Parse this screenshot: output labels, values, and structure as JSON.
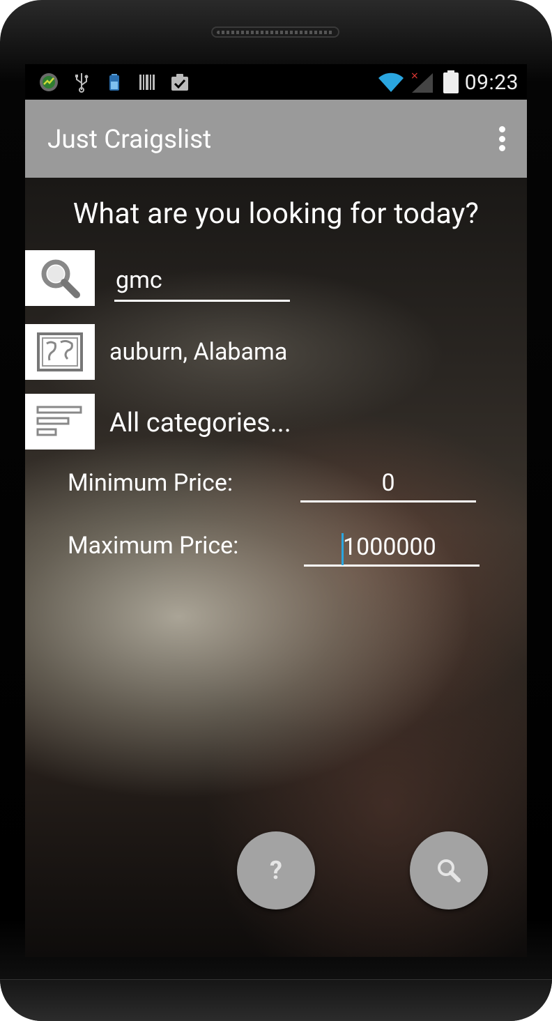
{
  "statusbar": {
    "time": "09:23",
    "left_icons": [
      "app-icon",
      "usb-icon",
      "battery-small-icon",
      "barcode-icon",
      "clipboard-check-icon"
    ],
    "right_icons": [
      "wifi-icon",
      "signal-icon",
      "battery-icon"
    ]
  },
  "appbar": {
    "title": "Just Craigslist"
  },
  "main": {
    "headline": "What are you looking for today?",
    "search_value": "gmc",
    "location": "auburn, Alabama",
    "category": "All categories...",
    "min_price_label": "Minimum Price:",
    "min_price_value": "0",
    "max_price_label": "Maximum Price:",
    "max_price_value": "1000000"
  },
  "fabs": {
    "help_label": "?"
  },
  "colors": {
    "appbar": "#9a9a9a",
    "statusbar": "#000000",
    "fab": "#a3a3a3",
    "cursor": "#2aa6e0"
  }
}
